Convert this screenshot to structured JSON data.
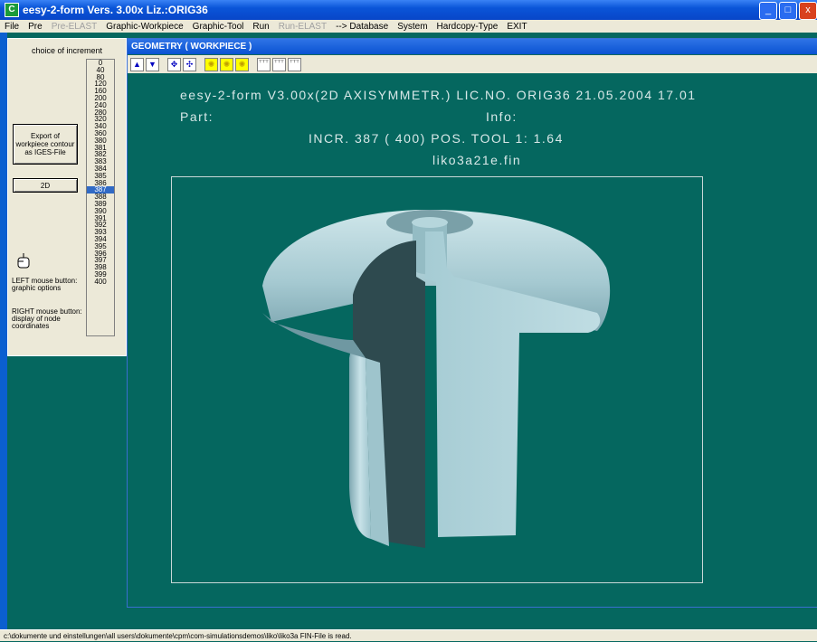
{
  "app": {
    "title": "eesy-2-form Vers. 3.00x  Liz.:ORIG36",
    "icon": "app-icon"
  },
  "window_buttons": {
    "minimize": "_",
    "maximize": "□",
    "close": "x"
  },
  "menu": [
    {
      "label": "File",
      "enabled": true
    },
    {
      "label": "Pre",
      "enabled": true
    },
    {
      "label": "Pre-ELAST",
      "enabled": false
    },
    {
      "label": "Graphic-Workpiece",
      "enabled": true
    },
    {
      "label": "Graphic-Tool",
      "enabled": true
    },
    {
      "label": "Run",
      "enabled": true
    },
    {
      "label": "Run-ELAST",
      "enabled": false
    },
    {
      "label": "--> Database",
      "enabled": true
    },
    {
      "label": "System",
      "enabled": true
    },
    {
      "label": "Hardcopy-Type",
      "enabled": true
    },
    {
      "label": "EXIT",
      "enabled": true
    }
  ],
  "left_panel": {
    "choice_label": "choice of increment",
    "export_button": "Export of workpiece contour as IGES-File",
    "twod_button": "2D",
    "left_mouse_text": "LEFT mouse button: graphic options",
    "right_mouse_text": "RIGHT mouse button: display of node coordinates",
    "increments": [
      "0",
      "40",
      "80",
      "120",
      "160",
      "200",
      "240",
      "280",
      "320",
      "340",
      "360",
      "380",
      "381",
      "382",
      "383",
      "384",
      "385",
      "386",
      "387",
      "388",
      "389",
      "390",
      "391",
      "392",
      "393",
      "394",
      "395",
      "396",
      "397",
      "398",
      "399",
      "400"
    ],
    "selected_increment": "387"
  },
  "geometry_window": {
    "title": "GEOMETRY   ( WORKPIECE )",
    "toolbar_icons": [
      "arrow-up-icon",
      "arrow-down-icon",
      "zoom-in-icon",
      "zoom-out-icon",
      "sun-icon-1",
      "sun-icon-2",
      "sun-icon-3",
      "view-1-icon",
      "view-2-icon",
      "view-3-icon"
    ],
    "header_line": "eesy-2-form  V3.00x(2D  AXISYMMETR.)    LIC.NO. ORIG36    21.05.2004   17.01",
    "part_label": "Part:",
    "info_label": "Info:",
    "incr_line": "INCR.   387  ( 400)       POS. TOOL    1:      1.64",
    "filename": "liko3a21e.fin"
  },
  "colors": {
    "background": "#05675f",
    "part_light": "#a8d0d8",
    "part_dark": "#2f4a4e",
    "selection": "#316ac5"
  },
  "status": "c:\\dokumente und einstellungen\\all users\\dokumente\\cpm\\com-simulationsdemos\\liko\\liko3a  FIN-File is read."
}
